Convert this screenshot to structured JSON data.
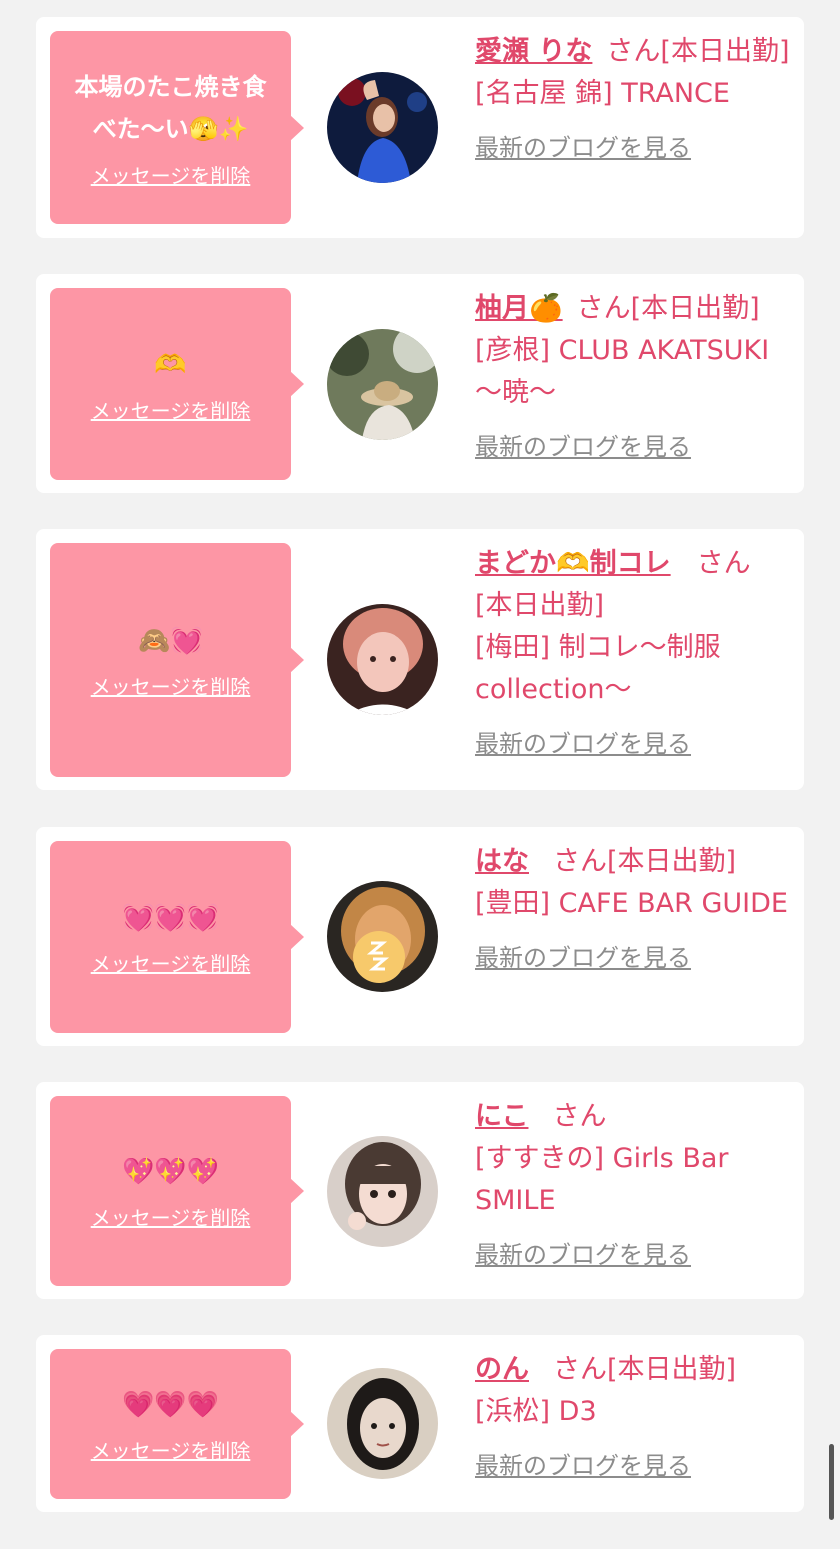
{
  "blog_link_label": "最新のブログを見る",
  "delete_label": "メッセージを削除",
  "honorific": "さん",
  "cards": [
    {
      "message": "本場のたこ焼き食\nべた〜い🫣✨",
      "name": "愛瀬 りな",
      "status": "[本日出勤]",
      "shop": "[名古屋 錦] TRANCE"
    },
    {
      "message": "🫶",
      "name": "柚月🍊",
      "status": "[本日出勤]",
      "shop": "[彦根] CLUB AKATSUKI 〜暁〜"
    },
    {
      "message": "🙈💓",
      "name": "まどか🫶制コレ",
      "status": "[本日出勤]",
      "shop": "[梅田] 制コレ〜制服collection〜"
    },
    {
      "message": "💓💓💓",
      "name": "はな",
      "status": "[本日出勤]",
      "shop": "[豊田] CAFE BAR GUIDE"
    },
    {
      "message": "💖💖💖",
      "name": "にこ",
      "status": "",
      "shop": "[すすきの] Girls Bar SMILE"
    },
    {
      "message": "💗💗💗",
      "name": "のん",
      "status": "[本日出勤]",
      "shop": "[浜松] D3"
    }
  ]
}
